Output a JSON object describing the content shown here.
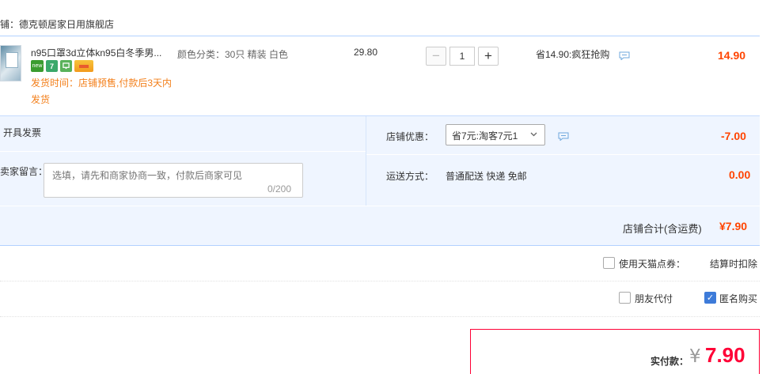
{
  "shop": {
    "name_line": "铺：德克顿居家日用旗舰店"
  },
  "item": {
    "title": "n95口罩3d立体kn95白冬季男...",
    "sku": "颜色分类：30只 精装 白色",
    "price": "29.80",
    "quantity": "1",
    "minus_symbol": "−",
    "plus_symbol": "+",
    "badges": {
      "new": "new",
      "seven": "7"
    },
    "ship_note": "发货时间：店铺预售,付款后3天内",
    "ship_note2": "发货",
    "promo": "省14.90:疯狂抢购",
    "total": "14.90"
  },
  "order": {
    "invoice_label": "开具发票",
    "note_label": "卖家留言：",
    "note_placeholder": "选填，请先和商家协商一致，付款后商家可见",
    "note_count": "0/200",
    "discount_label": "店铺优惠：",
    "discount_selected": "省7元:淘客7元1",
    "discount_amount": "-7.00",
    "shipping_label": "运送方式：",
    "shipping_method": "普通配送 快递 免邮",
    "shipping_amount": "0.00",
    "subtotal_label": "店铺合计(含运费)",
    "subtotal_amount": "¥7.90"
  },
  "options": {
    "points_label": "使用天猫点券：",
    "points_value": "结算时扣除",
    "friend_pay_label": "朋友代付",
    "anonymous_label": "匿名购买",
    "anonymous_checked": true,
    "check_mark": "✓"
  },
  "payment": {
    "label": "实付款：",
    "currency": "¥",
    "amount": "7.90"
  },
  "icons": {
    "chat": "chat-bubble-icon",
    "chevron": "chevron-down-icon"
  },
  "colors": {
    "accent": "#ff0036",
    "price": "#ff4400",
    "panel": "#eff5ff",
    "checkbox": "#3d7bd9",
    "ship_note": "#f37f1a"
  }
}
